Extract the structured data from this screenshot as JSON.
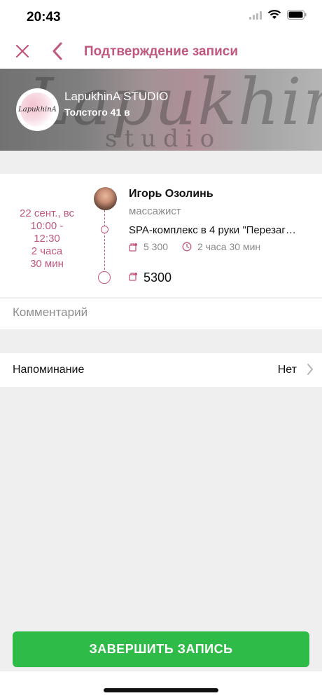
{
  "status_bar": {
    "time": "20:43"
  },
  "nav": {
    "title": "Подтверждение записи"
  },
  "salon": {
    "name": "LapukhinA STUDIO",
    "address": "Толстого 41 в",
    "logo_text": "LapukhinA",
    "banner_script": "LapukhinA",
    "banner_studio": "studio"
  },
  "appointment": {
    "date": "22 сент., вс",
    "time_from": "10:00 -",
    "time_to": "12:30",
    "duration_line1": "2 часа",
    "duration_line2": "30 мин",
    "master_name": "Игорь Озолинь",
    "master_role": "массажист",
    "service_name": "SPA-комплекс в 4 руки \"Перезаг…",
    "service_price": "5 300",
    "service_duration": "2 часа 30 мин",
    "total": "5300"
  },
  "comment": {
    "placeholder": "Комментарий"
  },
  "reminder": {
    "label": "Напоминание",
    "value": "Нет"
  },
  "actions": {
    "complete_label": "ЗАВЕРШИТЬ ЗАПИСЬ"
  },
  "colors": {
    "accent": "#c0577e",
    "success": "#2fbb47"
  },
  "icons": [
    "close-icon",
    "back-chevron-icon",
    "price-tag-icon",
    "clock-icon",
    "chevron-right-icon",
    "wifi-icon",
    "battery-icon",
    "signal-icon"
  ]
}
